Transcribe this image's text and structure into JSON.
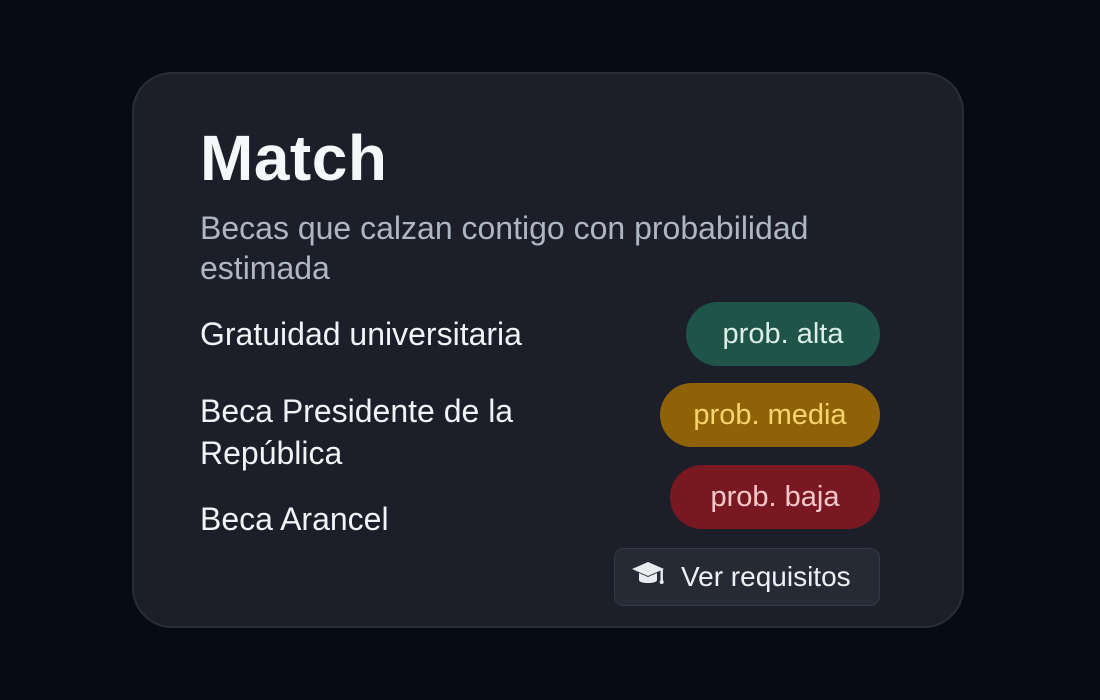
{
  "card": {
    "title": "Match",
    "subtitle": "Becas que calzan contigo con probabilidad estimada"
  },
  "scholarships": [
    {
      "name": "Gratuidad universitaria",
      "probability": "prob. alta",
      "level": "alta",
      "color": "#1f5549"
    },
    {
      "name": "Beca Presidente de la República",
      "probability": "prob. media",
      "level": "media",
      "color": "#8f6208"
    },
    {
      "name": "Beca Arancel",
      "probability": "prob. baja",
      "level": "baja",
      "color": "#7a1821"
    }
  ],
  "actions": {
    "requirements_label": "Ver requisitos",
    "requirements_icon": "graduation-cap-icon"
  },
  "colors": {
    "background": "#070b14",
    "card": "#1c1f29",
    "high": "#1f5549",
    "medium": "#8f6208",
    "low": "#7a1821"
  }
}
